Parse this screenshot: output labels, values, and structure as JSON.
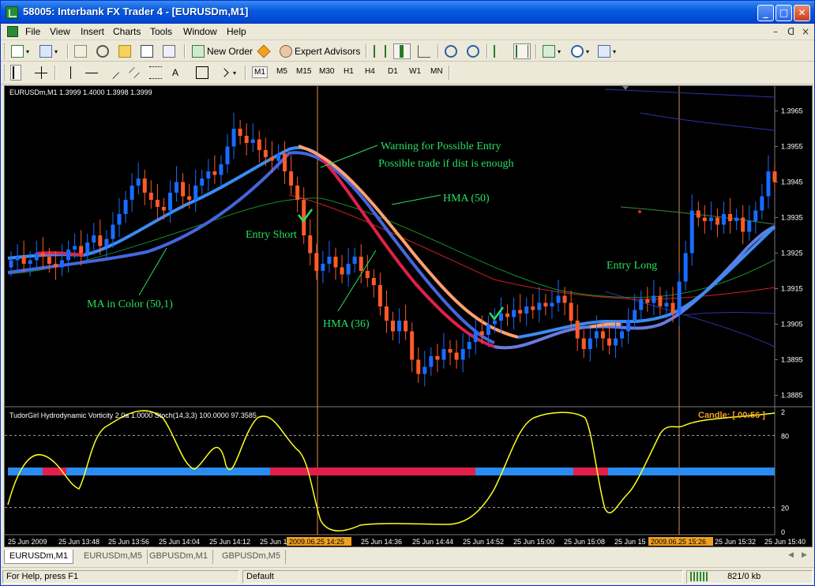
{
  "window": {
    "title": "58005: Interbank FX Trader 4 - [EURUSDm,M1]",
    "controls": {
      "minimize": "_",
      "maximize": "□",
      "close": "✕"
    }
  },
  "menu": {
    "items": [
      "File",
      "View",
      "Insert",
      "Charts",
      "Tools",
      "Window",
      "Help"
    ],
    "mdi_controls": [
      "–",
      "ᗡ",
      "×"
    ]
  },
  "toolbar": {
    "new_order": "New Order",
    "expert_advisors": "Expert Advisors",
    "timeframes": [
      "M1",
      "M5",
      "M15",
      "M30",
      "H1",
      "H4",
      "D1",
      "W1",
      "MN"
    ],
    "active_timeframe": "M1",
    "text_tool": "A"
  },
  "chart": {
    "header": "EURUSDm,M1  1.3999 1.4000 1.3998 1.3999",
    "indicator_header": "TudorGirl Hydrodynamic Vorticity 2.0a 1.0000  Stoch(14,3,3) 100.0000 97.3585",
    "candle_timer": "Candle: [ 00:56 ]",
    "osc_levels": [
      "2",
      "80",
      "20",
      "0"
    ],
    "time_labels": [
      "25 Jun 2009",
      "25 Jun 13:48",
      "25 Jun 13:56",
      "25 Jun 14:04",
      "25 Jun 14:12",
      "25 Jun 1",
      "25 Jun 14:36",
      "25 Jun 14:44",
      "25 Jun 14:52",
      "25 Jun 15:00",
      "25 Jun 15:08",
      "25 Jun 15",
      "25 Jun 15:32",
      "25 Jun 15:40"
    ],
    "crosshair_time_labels": [
      "2009.06.25 14:25",
      "2009.06.25 15:26"
    ],
    "annotations": {
      "warning": "Warning for Possible Entry",
      "possible": "Possible trade if dist is enough",
      "hma50": "HMA (50)",
      "entry_short": "Entry Short",
      "ma_color": "MA in Color (50,1)",
      "hma36": "HMA (36)",
      "entry_long": "Entry Long"
    },
    "colors": {
      "bull": "#1a6bff",
      "bear": "#ff5a2a",
      "hma_up": "#3a8cf0",
      "hma_down": "#e0204a",
      "hma_slow_down": "#ffa070",
      "signal_text": "#28e060",
      "stoch": "#ffff20",
      "vorticity_blue": "#2a8cf0",
      "vorticity_red": "#e0204a"
    }
  },
  "chart_data": {
    "type": "candlestick",
    "instrument": "EURUSDm,M1",
    "price_ticks": [
      1.3965,
      1.3955,
      1.3945,
      1.3935,
      1.3925,
      1.3915,
      1.3905,
      1.3895,
      1.3885
    ],
    "ylim": [
      1.3882,
      1.3972
    ],
    "closes": [
      1.3923,
      1.3924,
      1.3922,
      1.3923,
      1.3925,
      1.3924,
      1.3922,
      1.3921,
      1.3923,
      1.3926,
      1.3927,
      1.3925,
      1.3928,
      1.393,
      1.3927,
      1.3929,
      1.3933,
      1.3936,
      1.394,
      1.3944,
      1.3946,
      1.3942,
      1.394,
      1.3938,
      1.3937,
      1.3942,
      1.3945,
      1.3941,
      1.394,
      1.3944,
      1.3946,
      1.3948,
      1.3947,
      1.395,
      1.3955,
      1.396,
      1.3958,
      1.3956,
      1.3957,
      1.3954,
      1.3952,
      1.3951,
      1.3953,
      1.3948,
      1.3944,
      1.394,
      1.393,
      1.3925,
      1.392,
      1.3922,
      1.3924,
      1.3921,
      1.3919,
      1.3922,
      1.3924,
      1.392,
      1.3918,
      1.3916,
      1.391,
      1.3906,
      1.3903,
      1.3906,
      1.3903,
      1.3895,
      1.3891,
      1.3893,
      1.3896,
      1.3895,
      1.3898,
      1.3897,
      1.3895,
      1.3898,
      1.39,
      1.3903,
      1.3902,
      1.3905,
      1.3906,
      1.3908,
      1.3907,
      1.3909,
      1.3908,
      1.391,
      1.3909,
      1.3911,
      1.391,
      1.3911,
      1.3913,
      1.3911,
      1.3906,
      1.3901,
      1.3898,
      1.3901,
      1.3903,
      1.3901,
      1.3899,
      1.3901,
      1.3903,
      1.3906,
      1.3909,
      1.3912,
      1.3911,
      1.3913,
      1.391,
      1.3911,
      1.3908,
      1.3917,
      1.3925,
      1.3937,
      1.3935,
      1.3934,
      1.3935,
      1.3933,
      1.3936,
      1.3934,
      1.3935,
      1.3931,
      1.3934,
      1.3937,
      1.3941,
      1.3948,
      1.3945
    ]
  },
  "tabs": [
    "EURUSDm,M1",
    "EURUSDm,M5",
    "GBPUSDm,M1",
    "GBPUSDm,M5"
  ],
  "status": {
    "help": "For Help, press F1",
    "profile": "Default",
    "traffic": "821/0 kb"
  }
}
